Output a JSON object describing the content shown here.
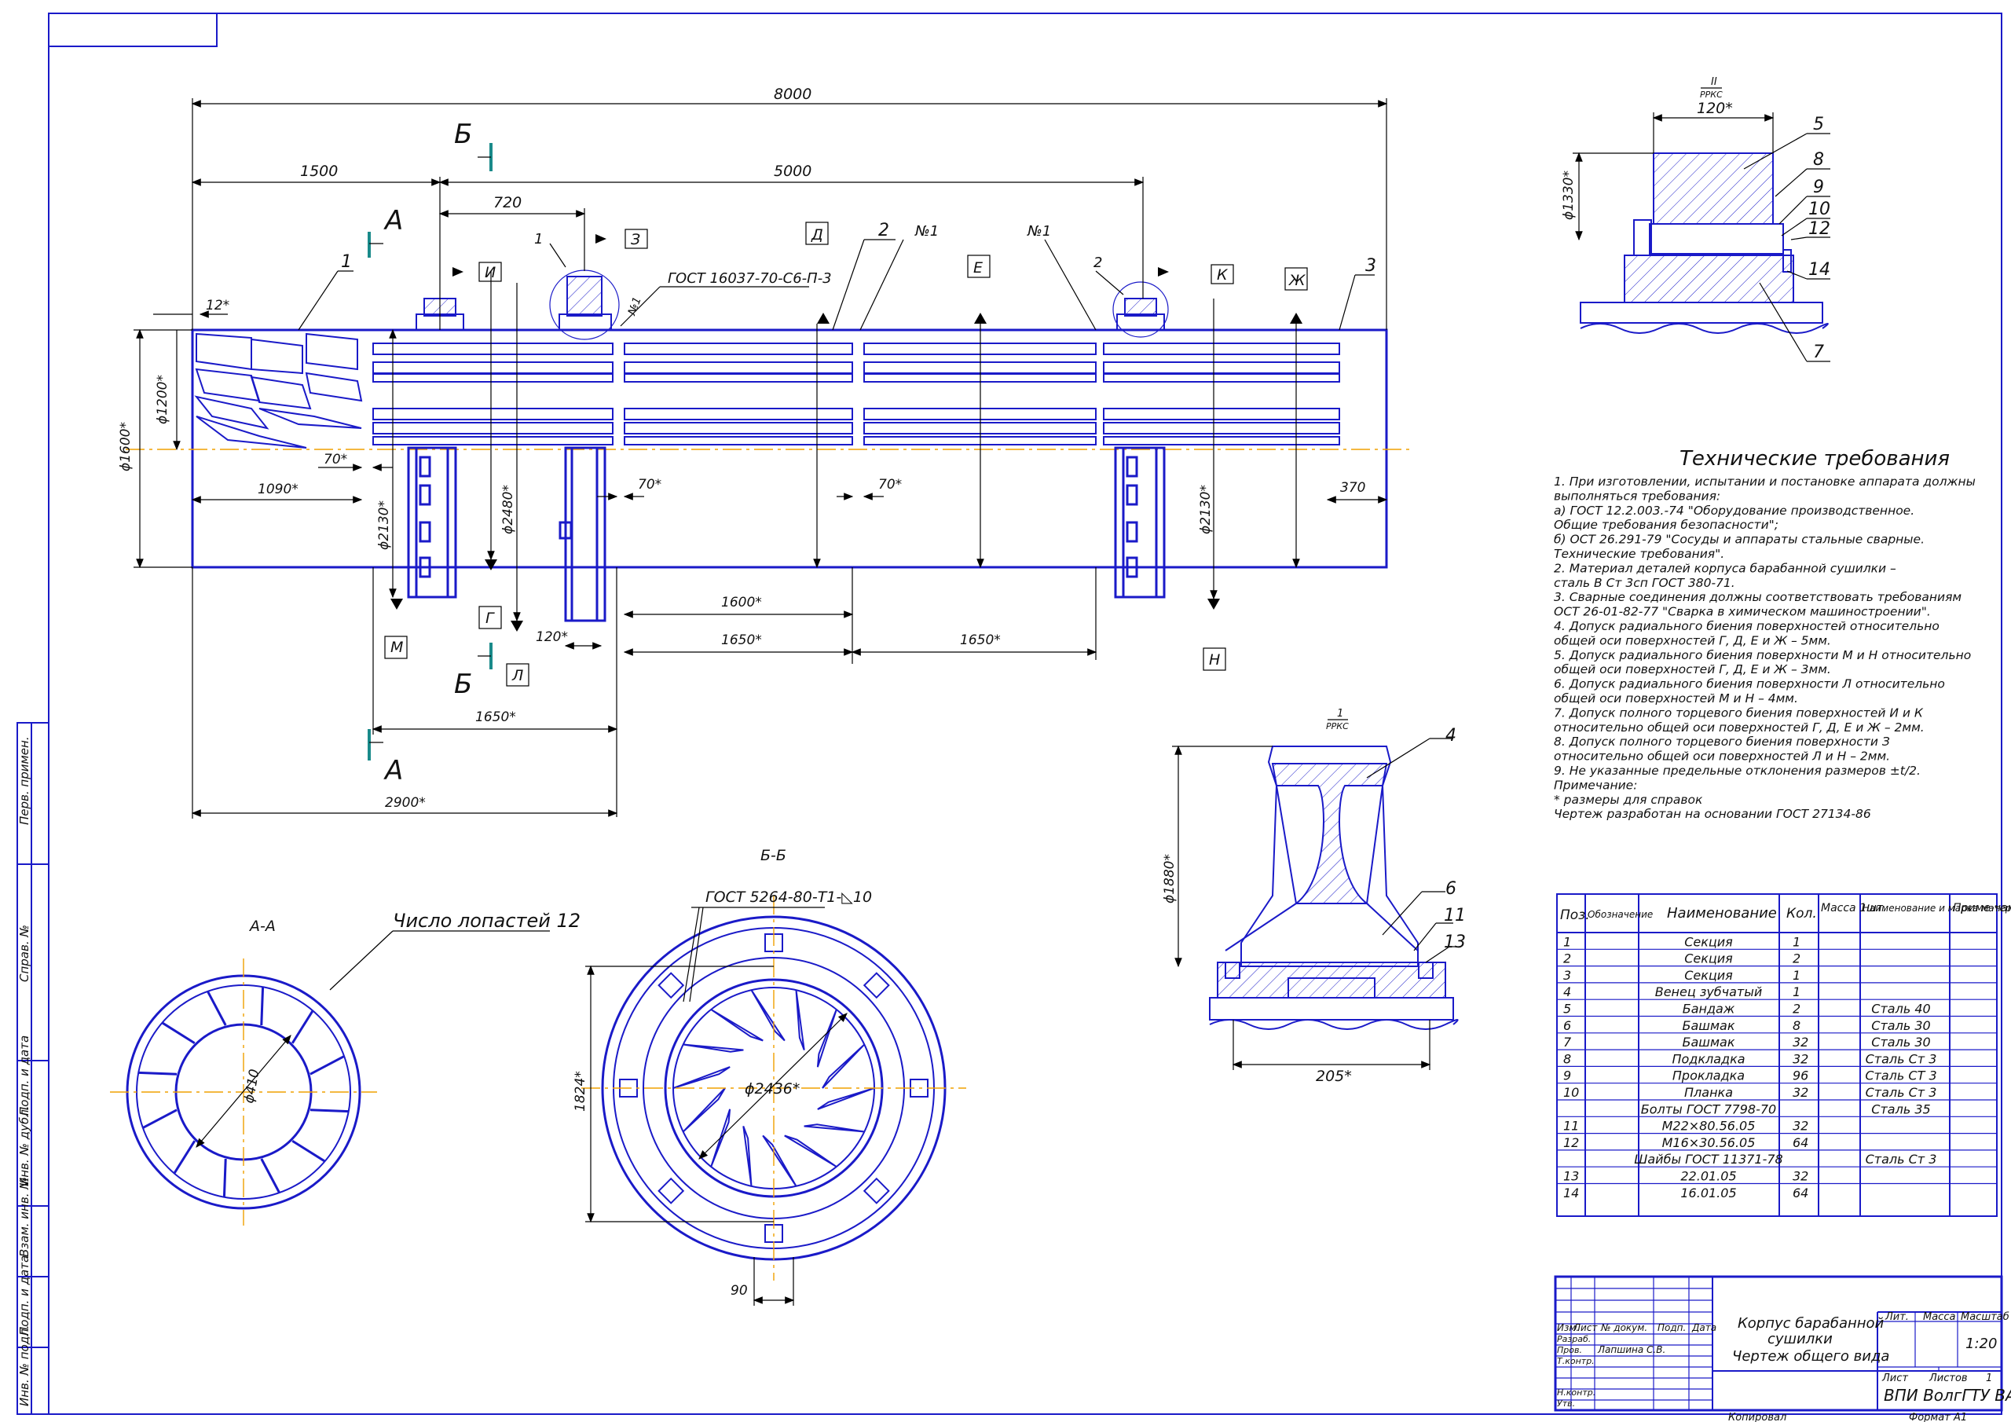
{
  "dims": {
    "d8000": "8000",
    "d1500": "1500",
    "d5000": "5000",
    "d720": "720",
    "d12": "12*",
    "d1600dia": "ϕ1600*",
    "d1200dia": "ϕ1200*",
    "d70a": "70*",
    "d70b": "70*",
    "d70c": "70*",
    "d1090": "1090*",
    "d2130a": "ϕ2130*",
    "d2480": "ϕ2480*",
    "d2130b": "ϕ2130*",
    "d370": "370",
    "d120": "120*",
    "d1600": "1600*",
    "d1650a": "1650*",
    "d1650b": "1650*",
    "d1650c": "1650*",
    "d2900": "2900*",
    "d120top": "120*",
    "d1330": "ϕ1330*",
    "d1880": "ϕ1880*",
    "d205": "205*",
    "d410": "ϕ410",
    "d2436": "ϕ2436*",
    "d1824": "1824*",
    "d90": "90"
  },
  "labels": {
    "secA1": "А",
    "secA2": "А",
    "secB1": "Б",
    "secB2": "Б",
    "callout1": "1",
    "callout2": "2",
    "callout3": "3",
    "callout1b": "1",
    "callout2b": "2",
    "n1a": "№1",
    "n1b": "№1",
    "n1c": "№1",
    "gost16037": "ГОСТ 16037-70-С6-П-3",
    "gost5264": "ГОСТ 5264-80-Т1-◺10",
    "bladeCount": "Число лопастей 12",
    "viewAA": "А-А",
    "viewBB": "Б-Б",
    "scaleTop": "II",
    "scaleTopDen": "РРКС",
    "scaleMid": "1",
    "scaleMidDen": "РРКС",
    "p5": "5",
    "p8": "8",
    "p9": "9",
    "p10": "10",
    "p12": "12",
    "p14": "14",
    "p7": "7",
    "p4": "4",
    "p6": "6",
    "p11": "11",
    "p13": "13"
  },
  "surfaces": {
    "s3": "З",
    "sI": "И",
    "sD": "Д",
    "sE": "Е",
    "sK": "К",
    "sZh": "Ж",
    "sM": "М",
    "sG": "Г",
    "sL": "Л",
    "sN": "Н"
  },
  "requirements": {
    "title": "Технические требования",
    "lines": [
      "1. При изготовлении, испытании и постановке аппарата должны",
      "   выполняться требования:",
      "   а) ГОСТ 12.2.003.-74 \"Оборудование производственное.",
      "      Общие требования безопасности\";",
      "   б) ОСТ 26.291-79 \"Сосуды и аппараты стальные сварные.",
      "      Технические требования\".",
      "2. Материал деталей корпуса барабанной сушилки –",
      "   сталь В Ст 3сп ГОСТ 380-71.",
      "3. Сварные соединения должны соответствовать требованиям",
      "   ОСТ 26-01-82-77 \"Сварка в химическом машиностроении\".",
      "4. Допуск радиального биения поверхностей относительно",
      "   общей оси поверхностей Г, Д, Е и Ж – 5мм.",
      "5. Допуск радиального биения поверхности М и Н относительно",
      "   общей оси поверхностей Г, Д, Е и Ж – 3мм.",
      "6. Допуск радиального биения поверхности Л относительно",
      "   общей оси поверхностей М и Н – 4мм.",
      "7. Допуск полного торцевого биения поверхностей И и К",
      "относительно общей оси поверхностей Г, Д, Е и Ж – 2мм.",
      "8. Допуск полного торцевого биения поверхности З",
      "относительно общей оси поверхностей Л и Н – 2мм.",
      "9. Не указанные предельные отклонения размеров ±t/2.",
      "Примечание:",
      " * размеры для справок",
      "Чертеж разработан на основании ГОСТ 27134-86"
    ]
  },
  "spec": {
    "headers": [
      "Поз.",
      "Обозначение",
      "Наименование",
      "Кол.",
      "Масса 1шт.",
      "Наименование и марка материала",
      "Приме-чание"
    ],
    "rows": [
      [
        "1",
        "",
        "Секция",
        "1",
        "",
        ""
      ],
      [
        "2",
        "",
        "Секция",
        "2",
        "",
        ""
      ],
      [
        "3",
        "",
        "Секция",
        "1",
        "",
        ""
      ],
      [
        "4",
        "",
        "Венец зубчатый",
        "1",
        "",
        ""
      ],
      [
        "5",
        "",
        "Бандаж",
        "2",
        "",
        "Сталь 40"
      ],
      [
        "6",
        "",
        "Башмак",
        "8",
        "",
        "Сталь 30"
      ],
      [
        "7",
        "",
        "Башмак",
        "32",
        "",
        "Сталь 30"
      ],
      [
        "8",
        "",
        "Подкладка",
        "32",
        "",
        "Сталь Ст 3"
      ],
      [
        "9",
        "",
        "Прокладка",
        "96",
        "",
        "Сталь СТ 3"
      ],
      [
        "10",
        "",
        "Планка",
        "32",
        "",
        "Сталь Ст 3"
      ],
      [
        "",
        "",
        "Болты ГОСТ 7798-70",
        "",
        "",
        "Сталь 35"
      ],
      [
        "11",
        "",
        "М22×80.56.05",
        "32",
        "",
        ""
      ],
      [
        "12",
        "",
        "М16×30.56.05",
        "64",
        "",
        ""
      ],
      [
        "",
        "",
        "Шайбы ГОСТ 11371-78",
        "",
        "",
        "Сталь Ст 3"
      ],
      [
        "13",
        "",
        "22.01.05",
        "32",
        "",
        ""
      ],
      [
        "14",
        "",
        "16.01.05",
        "64",
        "",
        ""
      ]
    ]
  },
  "titleblock": {
    "cols": [
      "Изм.",
      "Лист",
      "№ докум.",
      "Подп.",
      "Дата"
    ],
    "rows": [
      "Разраб.",
      "Пров.",
      "Т.контр.",
      "",
      "Н.контр.",
      "Утв."
    ],
    "checker": "Лапшина С.В.",
    "name1": "Корпус барабанной",
    "name2": "сушилки",
    "name3": "Чертеж общего вида",
    "lit": "Лит.",
    "mass": "Масса",
    "scale": "Масштаб",
    "scaleVal": "1:20",
    "sheet": "Лист",
    "sheets": "Листов",
    "sheetsVal": "1",
    "org": "ВПИ ВолгГТУ ВАУ",
    "copied": "Копировал",
    "format": "Формат",
    "formatVal": "А1"
  },
  "sidebar": [
    "Перв. примен.",
    "Справ. №",
    "Подп. и дата",
    "Инв. № дубл.",
    "Взам. инв. №",
    "Подп. и дата",
    "Инв. № подл."
  ]
}
